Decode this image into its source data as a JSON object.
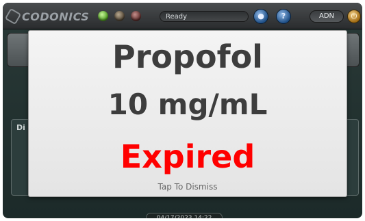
{
  "topbar": {
    "logo_text": "CODONICS",
    "status_text": "Ready",
    "help_icon": "help-icon",
    "user_label": "ADN",
    "indicator_colors": [
      "#7fd04a",
      "#7a6a55",
      "#8a4a48"
    ]
  },
  "background": {
    "panel_label": "Di"
  },
  "modal": {
    "drug_name": "Propofol",
    "concentration": "10 mg/mL",
    "status": "Expired",
    "status_color": "#ff0000",
    "dismiss_text": "Tap To Dismiss"
  },
  "footer": {
    "datetime": "04/17/2023 14:22"
  }
}
